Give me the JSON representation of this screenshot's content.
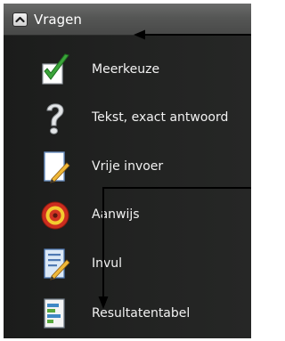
{
  "panel": {
    "title": "Vragen",
    "collapse_icon": "chevron-up-icon"
  },
  "items": [
    {
      "label": "Meerkeuze",
      "icon": "green-checkmark-icon"
    },
    {
      "label": "Tekst, exact antwoord",
      "icon": "question-mark-icon"
    },
    {
      "label": "Vrije invoer",
      "icon": "notepad-pencil-icon"
    },
    {
      "label": "Aanwijs",
      "icon": "target-icon"
    },
    {
      "label": "Invul",
      "icon": "form-pencil-icon"
    },
    {
      "label": "Resultatentabel",
      "icon": "results-table-icon"
    }
  ],
  "colors": {
    "panel_background": "#222322",
    "header_background": "#555655",
    "text": "#f2f2f2",
    "annotation_arrows": "#000000"
  }
}
